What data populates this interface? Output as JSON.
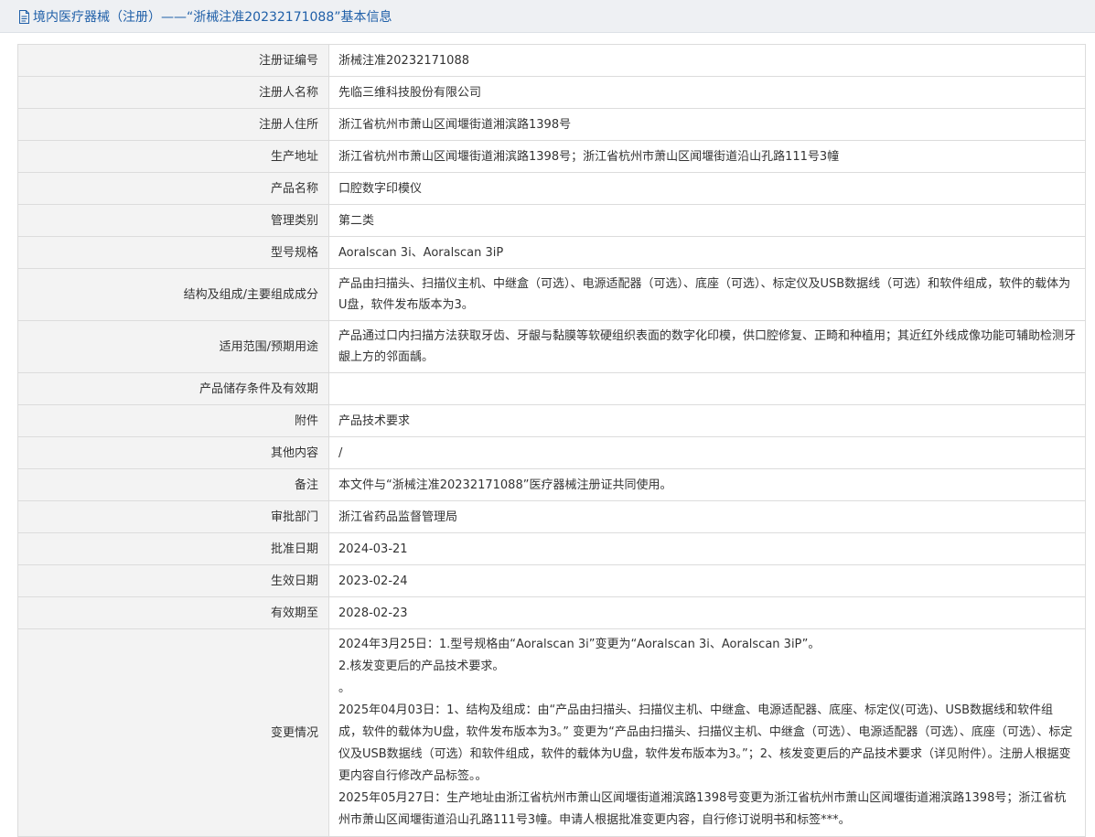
{
  "header": {
    "icon": "document-icon",
    "title": "境内医疗器械（注册）——“浙械注准20232171088”基本信息"
  },
  "colors": {
    "accent": "#1f5fa8",
    "label_bg": "#f3f3f3",
    "border": "#dcdcdc"
  },
  "rows": [
    {
      "label": "注册证编号",
      "value": "浙械注准20232171088"
    },
    {
      "label": "注册人名称",
      "value": "先临三维科技股份有限公司"
    },
    {
      "label": "注册人住所",
      "value": "浙江省杭州市萧山区闻堰街道湘滨路1398号"
    },
    {
      "label": "生产地址",
      "value": "浙江省杭州市萧山区闻堰街道湘滨路1398号；浙江省杭州市萧山区闻堰街道沿山孔路111号3幢"
    },
    {
      "label": "产品名称",
      "value": "口腔数字印模仪"
    },
    {
      "label": "管理类别",
      "value": "第二类"
    },
    {
      "label": "型号规格",
      "value": "Aoralscan 3i、Aoralscan 3iP"
    },
    {
      "label": "结构及组成/主要组成成分",
      "value": "产品由扫描头、扫描仪主机、中继盒（可选）、电源适配器（可选）、底座（可选）、标定仪及USB数据线（可选）和软件组成，软件的载体为U盘，软件发布版本为3。"
    },
    {
      "label": "适用范围/预期用途",
      "value": "产品通过口内扫描方法获取牙齿、牙龈与黏膜等软硬组织表面的数字化印模，供口腔修复、正畸和种植用；其近红外线成像功能可辅助检测牙龈上方的邻面龋。"
    },
    {
      "label": "产品储存条件及有效期",
      "value": ""
    },
    {
      "label": "附件",
      "value": "产品技术要求"
    },
    {
      "label": "其他内容",
      "value": "/"
    },
    {
      "label": "备注",
      "value": "本文件与“浙械注准20232171088”医疗器械注册证共同使用。"
    },
    {
      "label": "审批部门",
      "value": "浙江省药品监督管理局"
    },
    {
      "label": "批准日期",
      "value": "2024-03-21"
    },
    {
      "label": "生效日期",
      "value": "2023-02-24"
    },
    {
      "label": "有效期至",
      "value": "2028-02-23"
    }
  ],
  "changes": {
    "label": "变更情况",
    "lines": [
      "2024年3月25日：1.型号规格由“Aoralscan 3i”变更为“Aoralscan 3i、Aoralscan 3iP”。",
      "2.核发变更后的产品技术要求。",
      "。",
      "2025年04月03日：1、结构及组成：由“产品由扫描头、扫描仪主机、中继盒、电源适配器、底座、标定仪(可选)、USB数据线和软件组成，软件的载体为U盘，软件发布版本为3。” 变更为“产品由扫描头、扫描仪主机、中继盒（可选）、电源适配器（可选）、底座（可选）、标定仪及USB数据线（可选）和软件组成，软件的载体为U盘，软件发布版本为3。”；2、核发变更后的产品技术要求（详见附件）。注册人根据变更内容自行修改产品标签。。",
      "2025年05月27日：生产地址由浙江省杭州市萧山区闻堰街道湘滨路1398号变更为浙江省杭州市萧山区闻堰街道湘滨路1398号；浙江省杭州市萧山区闻堰街道沿山孔路111号3幢。申请人根据批准变更内容，自行修订说明书和标签***。"
    ]
  }
}
